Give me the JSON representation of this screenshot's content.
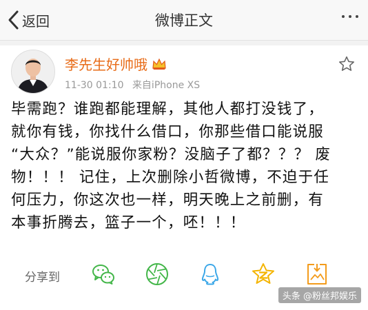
{
  "nav": {
    "back_label": "返回",
    "title": "微博正文"
  },
  "post": {
    "username": "李先生好帅哦",
    "time": "11-30 01:10",
    "source": "来自iPhone XS",
    "lines": [
      "毕需跑？谁跑都能理解，其他人都打没钱了，",
      "就你有钱，你找什么借口，你那些借口能说服",
      "“大众？”能说服你家粉？没脑子了都？？？ 废",
      "物！！！ 记住，上次删除小哲微博，不迫于任",
      "何压力，你这次也一样，明天晚上之前删，有",
      "本事折腾去，篮子一个，呸！！！"
    ]
  },
  "share": {
    "label": "分享到",
    "targets": [
      "wechat-icon",
      "moments-icon",
      "qq-icon",
      "qzone-icon",
      "save-image-icon"
    ]
  },
  "watermark": "头条 @粉丝邦娱乐",
  "colors": {
    "username": "#e86b17",
    "share_icon": "#43b649",
    "qq": "#3ba7e8",
    "qzone": "#f4b400",
    "save": "#f39b1b"
  }
}
